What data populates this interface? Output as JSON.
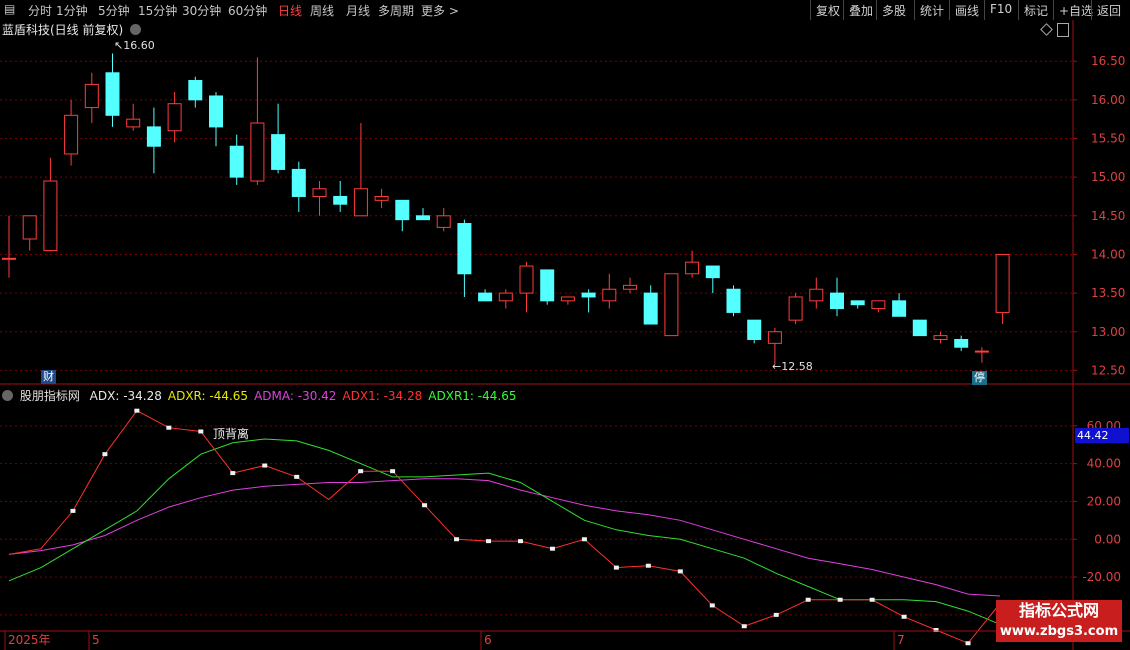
{
  "toolbar": {
    "periods": [
      "分时",
      "1分钟",
      "5分钟",
      "15分钟",
      "30分钟",
      "60分钟",
      "日线",
      "周线",
      "月线",
      "多周期",
      "更多 >"
    ],
    "active_index": 6,
    "right_buttons": [
      "复权",
      "叠加",
      "多股",
      "统计",
      "画线",
      "F10",
      "标记",
      "+自选",
      "返回"
    ]
  },
  "main_panel": {
    "title": "蓝盾科技(日线 前复权)",
    "high_label": "16.60",
    "low_label": "12.58",
    "finance_tag": "财",
    "halt_tag": "停",
    "y_ticks": [
      "16.50",
      "16.00",
      "15.50",
      "15.00",
      "14.50",
      "14.00",
      "13.50",
      "13.00",
      "12.50"
    ]
  },
  "indicator_panel": {
    "name": "股朋指标网",
    "legend": [
      {
        "label": "ADX: -34.28",
        "color": "#e8e8e8"
      },
      {
        "label": "ADXR: -44.65",
        "color": "#e8e800"
      },
      {
        "label": "ADMA: -30.42",
        "color": "#e040e0"
      },
      {
        "label": "ADX1: -34.28",
        "color": "#ff3030"
      },
      {
        "label": "ADXR1: -44.65",
        "color": "#30ff30"
      }
    ],
    "annotation": "顶背离",
    "current_value": "44.42",
    "y_ticks": [
      "60.00",
      "40.00",
      "20.00",
      "0.00",
      "-20.00",
      "-40.00"
    ]
  },
  "x_axis": {
    "labels": [
      "2025年",
      "5",
      "6",
      "7"
    ]
  },
  "watermark": {
    "line1": "指标公式网",
    "line2": "www.zbgs3.com"
  },
  "colors": {
    "up": "#ff3c3c",
    "down": "#54ffff",
    "grid": "#7a0000",
    "axis": "#a01010",
    "adx": "#ff3030",
    "adxr": "#30e030",
    "adma": "#e040e0"
  },
  "chart_data": {
    "type": "candlestick",
    "ohlc": [
      [
        13.95,
        14.5,
        13.7,
        13.95
      ],
      [
        14.2,
        14.5,
        14.05,
        14.5
      ],
      [
        14.05,
        15.25,
        14.05,
        14.95
      ],
      [
        15.3,
        16.0,
        15.15,
        15.8
      ],
      [
        15.9,
        16.35,
        15.7,
        16.2
      ],
      [
        16.35,
        16.6,
        15.65,
        15.8
      ],
      [
        15.65,
        15.95,
        15.6,
        15.75
      ],
      [
        15.65,
        15.9,
        15.05,
        15.4
      ],
      [
        15.6,
        16.1,
        15.45,
        15.95
      ],
      [
        16.25,
        16.3,
        15.9,
        16.0
      ],
      [
        16.05,
        16.1,
        15.4,
        15.65
      ],
      [
        15.4,
        15.55,
        14.9,
        15.0
      ],
      [
        14.95,
        16.55,
        14.9,
        15.7
      ],
      [
        15.55,
        15.95,
        15.05,
        15.1
      ],
      [
        15.1,
        15.2,
        14.55,
        14.75
      ],
      [
        14.75,
        14.95,
        14.5,
        14.85
      ],
      [
        14.75,
        14.95,
        14.55,
        14.65
      ],
      [
        14.5,
        15.7,
        14.5,
        14.85
      ],
      [
        14.7,
        14.85,
        14.6,
        14.75
      ],
      [
        14.7,
        14.7,
        14.3,
        14.45
      ],
      [
        14.5,
        14.6,
        14.45,
        14.45
      ],
      [
        14.35,
        14.6,
        14.3,
        14.5
      ],
      [
        14.4,
        14.45,
        13.45,
        13.75
      ],
      [
        13.5,
        13.55,
        13.4,
        13.4
      ],
      [
        13.4,
        13.55,
        13.3,
        13.5
      ],
      [
        13.5,
        13.9,
        13.25,
        13.85
      ],
      [
        13.8,
        13.8,
        13.35,
        13.4
      ],
      [
        13.4,
        13.45,
        13.35,
        13.45
      ],
      [
        13.5,
        13.55,
        13.25,
        13.45
      ],
      [
        13.4,
        13.75,
        13.3,
        13.55
      ],
      [
        13.55,
        13.7,
        13.5,
        13.6
      ],
      [
        13.5,
        13.6,
        13.1,
        13.1
      ],
      [
        12.95,
        13.75,
        12.95,
        13.75
      ],
      [
        13.75,
        14.05,
        13.7,
        13.9
      ],
      [
        13.85,
        13.85,
        13.5,
        13.7
      ],
      [
        13.55,
        13.6,
        13.2,
        13.25
      ],
      [
        13.15,
        13.15,
        12.85,
        12.9
      ],
      [
        12.85,
        13.05,
        12.58,
        13.0
      ],
      [
        13.15,
        13.5,
        13.1,
        13.45
      ],
      [
        13.4,
        13.7,
        13.3,
        13.55
      ],
      [
        13.5,
        13.7,
        13.2,
        13.3
      ],
      [
        13.4,
        13.4,
        13.3,
        13.35
      ],
      [
        13.3,
        13.4,
        13.25,
        13.4
      ],
      [
        13.4,
        13.5,
        13.2,
        13.2
      ],
      [
        13.15,
        13.15,
        12.95,
        12.95
      ],
      [
        12.9,
        13.0,
        12.85,
        12.95
      ],
      [
        12.9,
        12.95,
        12.75,
        12.8
      ],
      [
        12.75,
        12.8,
        12.6,
        12.75
      ],
      [
        13.25,
        14.0,
        13.1,
        14.0
      ]
    ],
    "ylim": [
      12.35,
      16.8
    ],
    "indicator": {
      "ylim": [
        -48,
        80
      ],
      "adx": [
        -8,
        -5,
        15,
        45,
        68,
        59,
        57,
        35,
        39,
        33,
        21,
        36,
        36,
        18,
        0,
        -1,
        -1,
        -5,
        0,
        -15,
        -14,
        -17,
        -35,
        -46,
        -40,
        -32,
        -32,
        -32,
        -41,
        -48,
        -55,
        -34
      ],
      "adxr": [
        -22,
        -15,
        -5,
        5,
        15,
        32,
        45,
        51,
        53,
        52,
        47,
        40,
        33,
        33,
        34,
        35,
        30,
        20,
        10,
        5,
        2,
        0,
        -5,
        -10,
        -18,
        -25,
        -32,
        -32,
        -32,
        -33,
        -38,
        -45
      ],
      "adma": [
        -8,
        -6,
        -3,
        2,
        10,
        17,
        22,
        26,
        28,
        29,
        30,
        30,
        31,
        32,
        32,
        31,
        26,
        22,
        18,
        15,
        13,
        10,
        5,
        0,
        -5,
        -10,
        -13,
        -16,
        -20,
        -24,
        -29,
        -30
      ],
      "adx_markers": [
        2,
        3,
        4,
        5,
        6,
        7,
        8,
        9,
        11,
        12,
        13,
        14,
        15,
        16,
        17,
        18,
        19,
        20,
        21,
        22,
        23,
        24,
        25,
        26,
        27,
        28,
        29,
        30,
        31
      ]
    }
  }
}
